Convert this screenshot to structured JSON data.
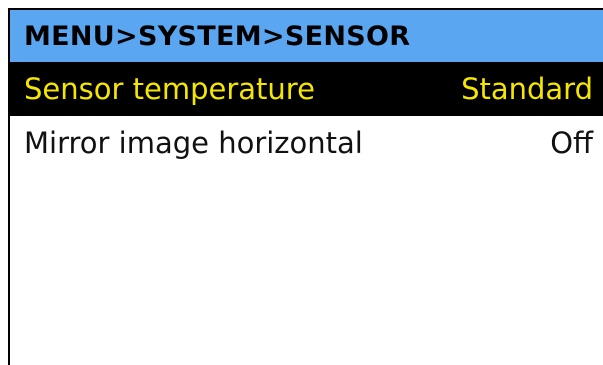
{
  "header": {
    "breadcrumb": "MENU>SYSTEM>SENSOR"
  },
  "menu": {
    "items": [
      {
        "label": "Sensor temperature",
        "value": "Standard",
        "selected": true
      },
      {
        "label": "Mirror image horizontal",
        "value": "Off",
        "selected": false
      }
    ]
  },
  "colors": {
    "title_bar": "#5aa6f0",
    "selected_bg": "#000000",
    "selected_text": "#f5e600",
    "normal_text": "#111111",
    "background": "#ffffff"
  }
}
